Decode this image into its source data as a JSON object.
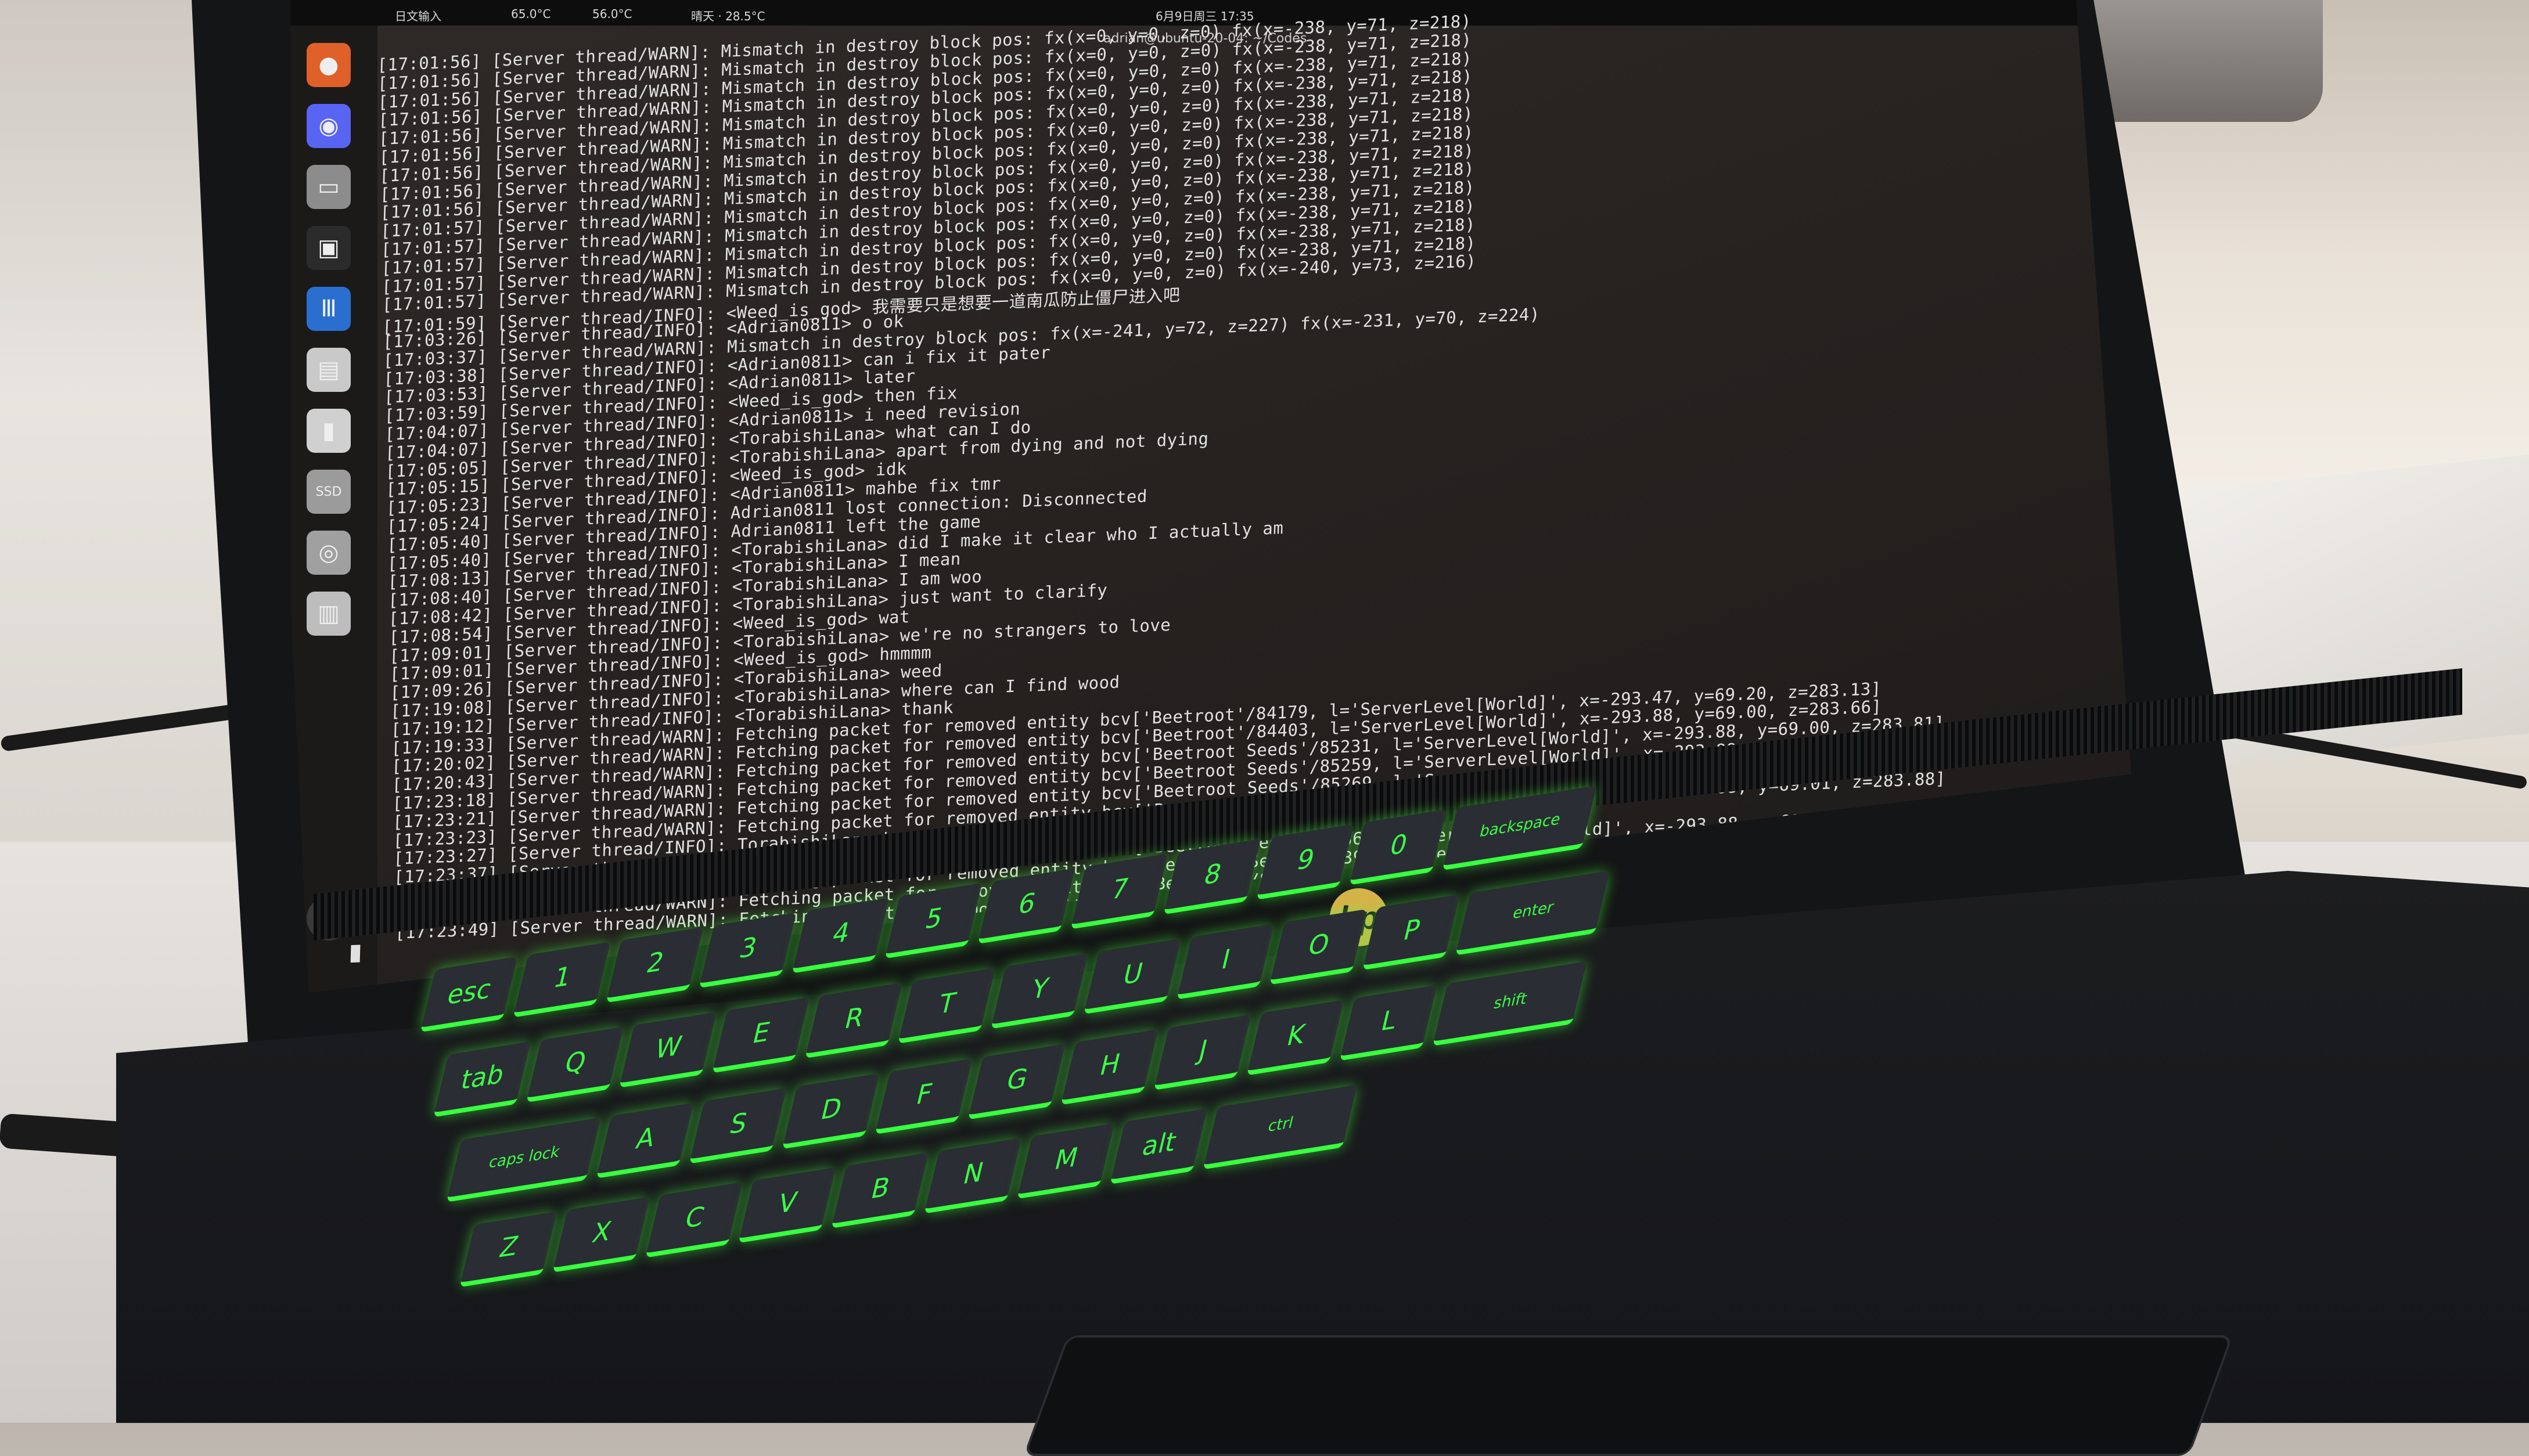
{
  "topbar": {
    "left": "日文输入",
    "temp1": "65.0°C",
    "temp2": "56.0°C",
    "weather": "晴天 · 28.5°C",
    "center": "6月9日周三 17:35"
  },
  "window": {
    "title": "adrian@ubuntu-20-04: ~/Codes"
  },
  "dock": {
    "items": [
      {
        "name": "firefox-icon",
        "glyph": "●",
        "color": "#e0602a"
      },
      {
        "name": "discord-icon",
        "glyph": "◉",
        "color": "#5865f2"
      },
      {
        "name": "files-icon",
        "glyph": "▭",
        "color": "#8c8c8c"
      },
      {
        "name": "terminal-icon",
        "glyph": "▣",
        "color": "#2b2b2b"
      },
      {
        "name": "equalizer-icon",
        "glyph": "Ⅲ",
        "color": "#2a6fd0"
      },
      {
        "name": "document-viewer-icon",
        "glyph": "▤",
        "color": "#c9c9c9"
      },
      {
        "name": "media-player-icon",
        "glyph": "▮",
        "color": "#d0d0d0"
      },
      {
        "name": "ssd-drive-icon",
        "glyph": "SSD",
        "color": "#9b9b9b"
      },
      {
        "name": "disk-icon",
        "glyph": "◎",
        "color": "#a0a0a0"
      },
      {
        "name": "sd-card-icon",
        "glyph": "▥",
        "color": "#bdbdbd"
      }
    ],
    "launcher": "⠿"
  },
  "terminal": {
    "lines": [
      "[17:01:56] [Server thread/WARN]: Mismatch in destroy block pos: fx(x=0, y=0, z=0) fx(x=-238, y=71, z=218)",
      "[17:01:56] [Server thread/WARN]: Mismatch in destroy block pos: fx(x=0, y=0, z=0) fx(x=-238, y=71, z=218)",
      "[17:01:56] [Server thread/WARN]: Mismatch in destroy block pos: fx(x=0, y=0, z=0) fx(x=-238, y=71, z=218)",
      "[17:01:56] [Server thread/WARN]: Mismatch in destroy block pos: fx(x=0, y=0, z=0) fx(x=-238, y=71, z=218)",
      "[17:01:56] [Server thread/WARN]: Mismatch in destroy block pos: fx(x=0, y=0, z=0) fx(x=-238, y=71, z=218)",
      "[17:01:56] [Server thread/WARN]: Mismatch in destroy block pos: fx(x=0, y=0, z=0) fx(x=-238, y=71, z=218)",
      "[17:01:56] [Server thread/WARN]: Mismatch in destroy block pos: fx(x=0, y=0, z=0) fx(x=-238, y=71, z=218)",
      "[17:01:56] [Server thread/WARN]: Mismatch in destroy block pos: fx(x=0, y=0, z=0) fx(x=-238, y=71, z=218)",
      "[17:01:56] [Server thread/WARN]: Mismatch in destroy block pos: fx(x=0, y=0, z=0) fx(x=-238, y=71, z=218)",
      "[17:01:57] [Server thread/WARN]: Mismatch in destroy block pos: fx(x=0, y=0, z=0) fx(x=-238, y=71, z=218)",
      "[17:01:57] [Server thread/WARN]: Mismatch in destroy block pos: fx(x=0, y=0, z=0) fx(x=-238, y=71, z=218)",
      "[17:01:57] [Server thread/WARN]: Mismatch in destroy block pos: fx(x=0, y=0, z=0) fx(x=-238, y=71, z=218)",
      "[17:01:57] [Server thread/WARN]: Mismatch in destroy block pos: fx(x=0, y=0, z=0) fx(x=-238, y=71, z=218)",
      "[17:01:57] [Server thread/WARN]: Mismatch in destroy block pos: fx(x=0, y=0, z=0) fx(x=-240, y=73, z=216)",
      "[17:01:59] [Server thread/INFO]: <Weed_is_god> 我需要只是想要一道南瓜防止僵尸进入吧",
      "[17:03:26] [Server thread/INFO]: <Adrian0811> o ok",
      "[17:03:37] [Server thread/WARN]: Mismatch in destroy block pos: fx(x=-241, y=72, z=227) fx(x=-231, y=70, z=224)",
      "[17:03:38] [Server thread/INFO]: <Adrian0811> can i fix it pater",
      "[17:03:53] [Server thread/INFO]: <Adrian0811> later",
      "[17:03:59] [Server thread/INFO]: <Weed_is_god> then fix",
      "[17:04:07] [Server thread/INFO]: <Adrian0811> i need revision",
      "[17:04:07] [Server thread/INFO]: <TorabishiLana> what can I do",
      "[17:05:05] [Server thread/INFO]: <TorabishiLana> apart from dying and not dying",
      "[17:05:15] [Server thread/INFO]: <Weed_is_god> idk",
      "[17:05:23] [Server thread/INFO]: <Adrian0811> mahbe fix tmr",
      "[17:05:24] [Server thread/INFO]: Adrian0811 lost connection: Disconnected",
      "[17:05:40] [Server thread/INFO]: Adrian0811 left the game",
      "[17:05:40] [Server thread/INFO]: <TorabishiLana> did I make it clear who I actually am",
      "[17:08:13] [Server thread/INFO]: <TorabishiLana> I mean",
      "[17:08:40] [Server thread/INFO]: <TorabishiLana> I am woo",
      "[17:08:42] [Server thread/INFO]: <TorabishiLana> just want to clarify",
      "[17:08:54] [Server thread/INFO]: <Weed_is_god> wat",
      "[17:09:01] [Server thread/INFO]: <TorabishiLana> we're no strangers to love",
      "[17:09:01] [Server thread/INFO]: <Weed_is_god> hmmmm",
      "[17:09:26] [Server thread/INFO]: <TorabishiLana> weed",
      "[17:19:08] [Server thread/INFO]: <TorabishiLana> where can I find wood",
      "[17:19:12] [Server thread/INFO]: <TorabishiLana> thank",
      "[17:19:33] [Server thread/WARN]: Fetching packet for removed entity bcv['Beetroot'/84179, l='ServerLevel[World]', x=-293.47, y=69.20, z=283.13]",
      "[17:20:02] [Server thread/WARN]: Fetching packet for removed entity bcv['Beetroot'/84403, l='ServerLevel[World]', x=-293.88, y=69.00, z=283.66]",
      "[17:20:43] [Server thread/WARN]: Fetching packet for removed entity bcv['Beetroot Seeds'/85231, l='ServerLevel[World]', x=-293.88, y=69.00, z=283.81]",
      "[17:23:18] [Server thread/WARN]: Fetching packet for removed entity bcv['Beetroot Seeds'/85259, l='ServerLevel[World]', x=-293.88, y=69.13, z=283.88]",
      "[17:23:21] [Server thread/WARN]: Fetching packet for removed entity bcv['Beetroot Seeds'/85269, l='ServerLevel[World]', x=-293.88, y=69.01, z=283.88]",
      "[17:23:23] [Server thread/WARN]: Fetching packet for removed entity bcv['Beetroot Seeds'/85285, l='ServerLevel[World]', x=-293.88, y=69.01, z=283.88]",
      "[17:23:27] [Server thread/INFO]: TorabishiLana has made the advancement [Suit Up]",
      "[17:23:37] [Server thread/WARN]: Fetching packet for removed entity bcv['Beetroot Seeds'/85362, l='ServerLevel[World]', x=-293.88, y=69.00, z=283.88]",
      "[17:23:41] [Server thread/WARN]: Fetching packet for removed entity bcv['Beetroot Seeds'/85396, l='ServerLevel[World]', x=-293.83, y=69.13, z=283.88]",
      "[17:23:45] [Server thread/WARN]: Fetching packet for removed entity bcv['Beetroot'/85401, l='ServerLevel[World]', x=-293.88, y=69.07, z=283.88]",
      "[17:23:49] [Server thread/WARN]: Fetching packet for removed entity bcv['Beetroot'/85410, l='ServerLevel[World]', x=-293.88, y=69.00, z=283.88]"
    ]
  },
  "brand": {
    "logo": "hp"
  },
  "keyboard": {
    "rows": [
      [
        "esc",
        "!\n1",
        "@\n2",
        "#\n3",
        "$\n4",
        "%\n5",
        "^\n6",
        "&\n7",
        "*\n8",
        "(\n9",
        ")\n0",
        "backspace"
      ],
      [
        "tab",
        "Q",
        "W",
        "E",
        "R",
        "T",
        "Y",
        "U",
        "I",
        "O",
        "P",
        "enter"
      ],
      [
        "caps lock",
        "A",
        "S",
        "D",
        "F",
        "G",
        "H",
        "J",
        "K",
        "L",
        "shift"
      ],
      [
        "Z",
        "X",
        "C",
        "V",
        "B",
        "N",
        "M",
        "alt",
        "ctrl"
      ]
    ]
  },
  "colors": {
    "accent": "#38ff3f",
    "logo": "#d8b24a"
  }
}
